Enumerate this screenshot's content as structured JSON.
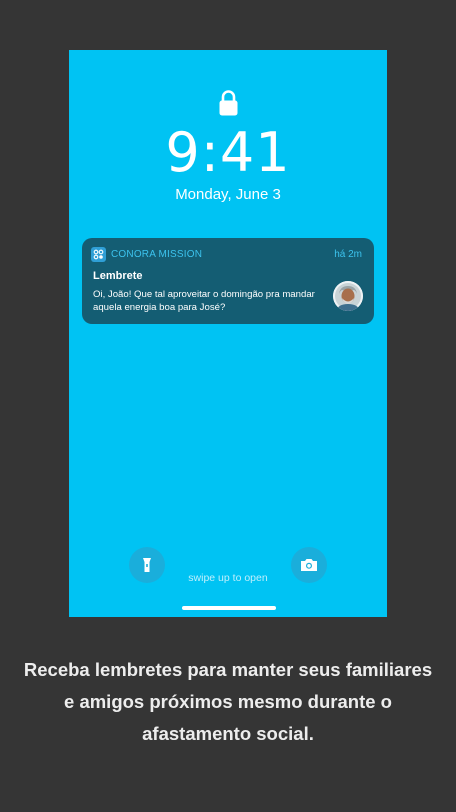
{
  "lockscreen": {
    "time": "9:41",
    "date": "Monday, June 3",
    "swipe_hint": "swipe up to open"
  },
  "notification": {
    "app_name": "CONORA MISSION",
    "timestamp": "há 2m",
    "title": "Lembrete",
    "body": "Oi, João! Que tal aproveitar o domingão pra mandar aquela energia boa para José?"
  },
  "caption": {
    "text": "Receba lembretes para manter seus familiares e amigos próximos mesmo durante o afastamento social."
  },
  "icons": {
    "lock": "lock-icon",
    "app": "conora-app-icon",
    "avatar": "contact-avatar",
    "flashlight": "flashlight-icon",
    "camera": "camera-icon"
  },
  "colors": {
    "background": "#353535",
    "screen": "#00c3f3",
    "notification": "#145d73",
    "notification_accent": "#3cc3ee",
    "button": "#1aaedb"
  }
}
